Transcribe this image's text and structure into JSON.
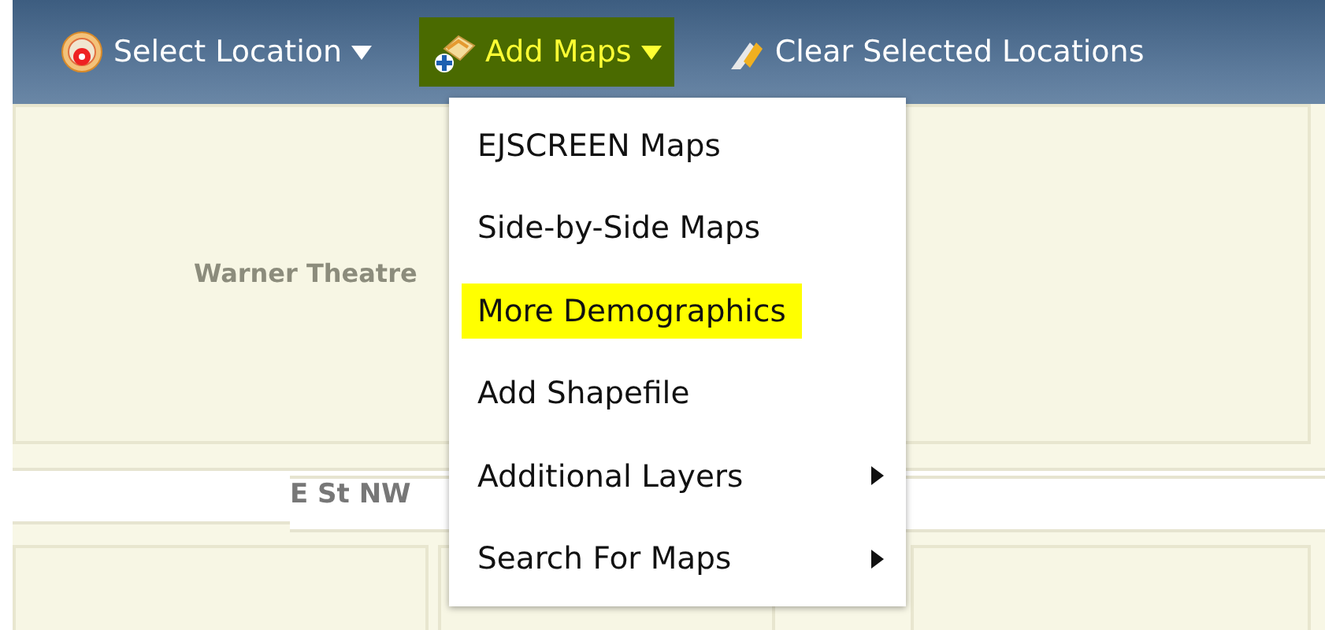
{
  "toolbar": {
    "items": [
      {
        "label": "Select Location",
        "kind": "dropdown",
        "highlighted": false
      },
      {
        "label": "Add Maps",
        "kind": "dropdown",
        "highlighted": true
      },
      {
        "label": "Clear Selected Locations",
        "kind": "action",
        "highlighted": false
      }
    ]
  },
  "menu": {
    "items": [
      {
        "label": "EJSCREEN Maps",
        "submenu": false,
        "highlighted": false
      },
      {
        "label": "Side-by-Side Maps",
        "submenu": false,
        "highlighted": false
      },
      {
        "label": "More Demographics",
        "submenu": false,
        "highlighted": true
      },
      {
        "label": "Add Shapefile",
        "submenu": false,
        "highlighted": false
      },
      {
        "label": "Additional Layers",
        "submenu": true,
        "highlighted": false
      },
      {
        "label": "Search For Maps",
        "submenu": true,
        "highlighted": false
      }
    ]
  },
  "map": {
    "labels": [
      {
        "text": "Warner Theatre",
        "kind": "building"
      },
      {
        "text": "E St NW",
        "kind": "street"
      }
    ]
  }
}
